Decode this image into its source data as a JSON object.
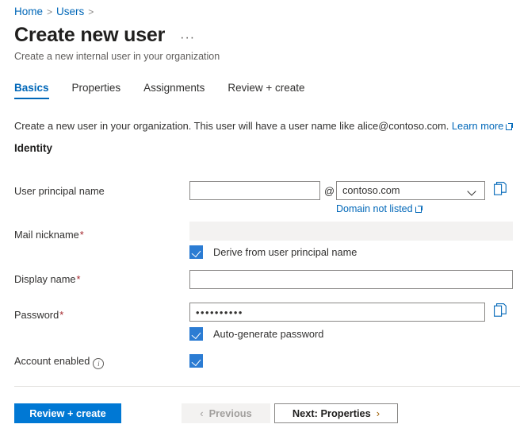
{
  "breadcrumb": {
    "items": [
      "Home",
      "Users"
    ],
    "separator": ">"
  },
  "header": {
    "title": "Create new user",
    "subtitle": "Create a new internal user in your organization",
    "more_menu": "···"
  },
  "tabs": [
    {
      "label": "Basics",
      "active": true
    },
    {
      "label": "Properties",
      "active": false
    },
    {
      "label": "Assignments",
      "active": false
    },
    {
      "label": "Review + create",
      "active": false
    }
  ],
  "description": {
    "text": "Create a new user in your organization. This user will have a user name like alice@contoso.com.",
    "link_label": "Learn more",
    "link_icon": "external-link-icon"
  },
  "section": {
    "heading": "Identity"
  },
  "fields": {
    "upn": {
      "label": "User principal name",
      "required": false,
      "value": "",
      "placeholder": "",
      "at_symbol": "@",
      "domain_value": "contoso.com",
      "domain_link": "Domain not listed",
      "copy_icon": "copy-icon"
    },
    "mail_nickname": {
      "label": "Mail nickname",
      "required": true,
      "value": "",
      "disabled": true,
      "checkbox_label": "Derive from user principal name",
      "checkbox_checked": true
    },
    "display_name": {
      "label": "Display name",
      "required": true,
      "value": "",
      "placeholder": ""
    },
    "password": {
      "label": "Password",
      "required": true,
      "value": "••••••••••",
      "copy_icon": "copy-icon",
      "checkbox_label": "Auto-generate password",
      "checkbox_checked": true
    },
    "account_enabled": {
      "label": "Account enabled",
      "info_icon": "info-icon",
      "checked": true
    }
  },
  "footer": {
    "review_create": "Review + create",
    "previous": "Previous",
    "previous_icon": "‹",
    "next": "Next: Properties",
    "next_icon": "›"
  },
  "colors": {
    "accent": "#0078d4",
    "link": "#0067b8",
    "required": "#a4262c",
    "checkbox": "#2b7cd3"
  }
}
